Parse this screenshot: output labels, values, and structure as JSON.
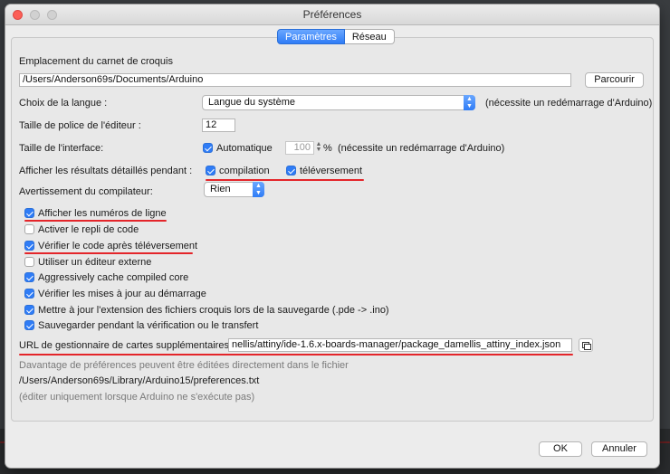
{
  "window": {
    "title": "Préférences"
  },
  "tabs": [
    {
      "label": "Paramètres",
      "active": true
    },
    {
      "label": "Réseau",
      "active": false
    }
  ],
  "sketchbook": {
    "label": "Emplacement du carnet de croquis",
    "value": "/Users/Anderson69s/Documents/Arduino",
    "browse": "Parcourir"
  },
  "language": {
    "label": "Choix de la langue :",
    "value": "Langue du système",
    "note": "(nécessite un redémarrage d'Arduino)"
  },
  "font_size": {
    "label": "Taille de police de l'éditeur :",
    "value": "12"
  },
  "interface": {
    "label": "Taille de l'interface:",
    "auto_label": "Automatique",
    "auto_checked": true,
    "value": "100",
    "unit": "%",
    "note": "(nécessite un redémarrage d'Arduino)"
  },
  "verbose": {
    "label": "Afficher les résultats détaillés pendant :",
    "compilation": "compilation",
    "compilation_checked": true,
    "upload": "téléversement",
    "upload_checked": true
  },
  "warnings": {
    "label": "Avertissement du compilateur:",
    "value": "Rien"
  },
  "options": [
    {
      "label": "Afficher les numéros de ligne",
      "checked": true
    },
    {
      "label": "Activer le repli de code",
      "checked": false
    },
    {
      "label": "Vérifier le code après téléversement",
      "checked": true
    },
    {
      "label": "Utiliser un éditeur externe",
      "checked": false
    },
    {
      "label": "Aggressively cache compiled core",
      "checked": true
    },
    {
      "label": "Vérifier les mises à jour au démarrage",
      "checked": true
    },
    {
      "label": "Mettre à jour  l'extension des fichiers croquis lors de la sauvegarde (.pde -> .ino)",
      "checked": true
    },
    {
      "label": "Sauvegarder pendant la vérification ou le transfert",
      "checked": true
    }
  ],
  "boards_url": {
    "label": "URL de gestionnaire de cartes supplémentaires",
    "value": "nellis/attiny/ide-1.6.x-boards-manager/package_damellis_attiny_index.json"
  },
  "more": {
    "text": "Davantage de préférences peuvent être éditées directement dans le fichier",
    "path": "/Users/Anderson69s/Library/Arduino15/preferences.txt",
    "note": "(éditer uniquement lorsque Arduino ne s'exécute pas)"
  },
  "buttons": {
    "ok": "OK",
    "cancel": "Annuler"
  },
  "colors": {
    "accent": "#2f7cf6",
    "highlight": "#e4252a",
    "close": "#fc5f57"
  }
}
